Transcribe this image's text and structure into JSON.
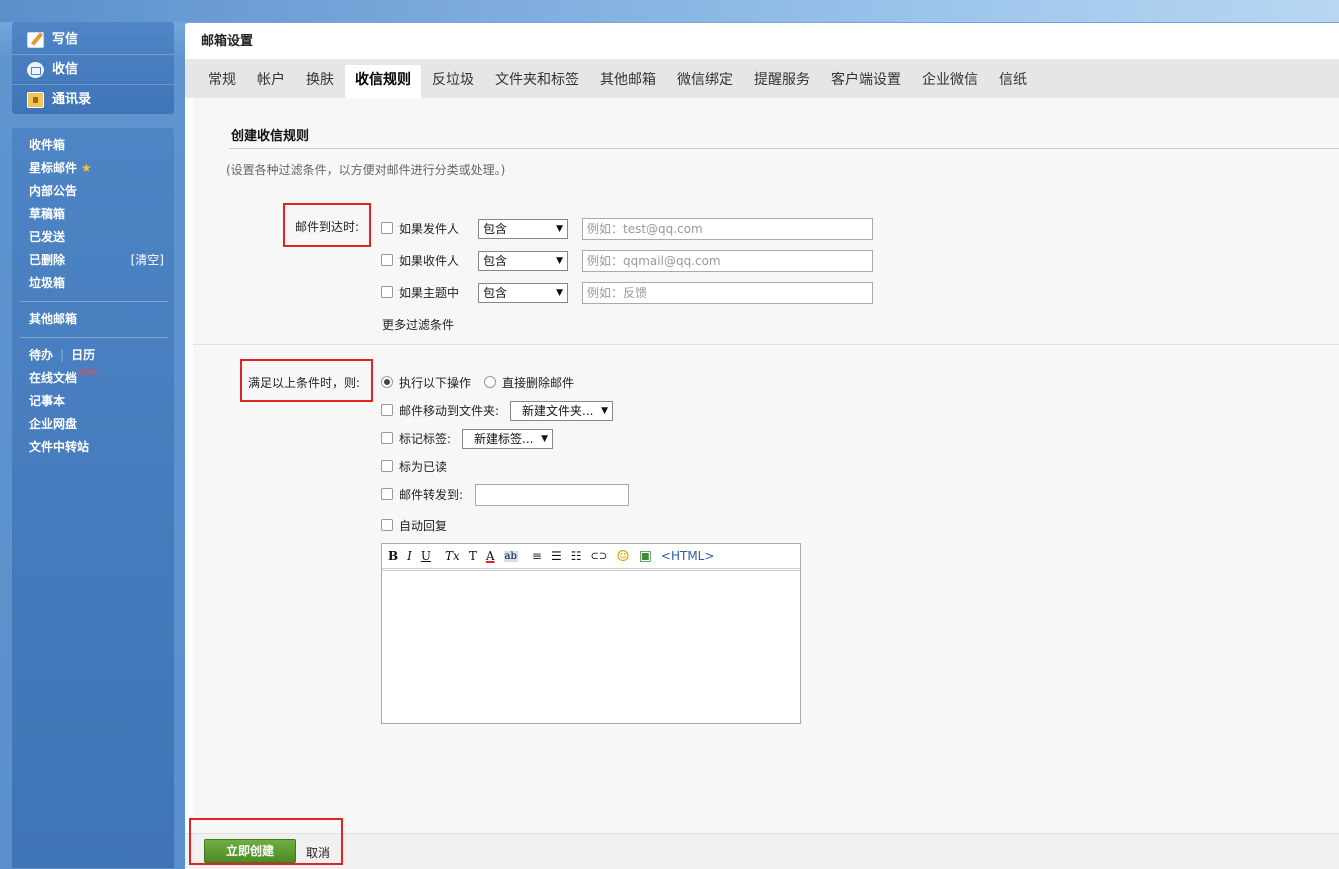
{
  "sidebar": {
    "primary": [
      {
        "label": "写信",
        "icon": "pen-icon"
      },
      {
        "label": "收信",
        "icon": "inbox-icon"
      },
      {
        "label": "通讯录",
        "icon": "contacts-icon"
      }
    ],
    "folders": [
      "收件箱",
      "星标邮件",
      "内部公告",
      "草稿箱",
      "已发送",
      "已删除",
      "垃圾箱"
    ],
    "star": "★",
    "clear": "[清空]",
    "other_mailbox": "其他邮箱",
    "todo": "待办",
    "divider": "|",
    "calendar": "日历",
    "docs": "在线文档",
    "new_badge": "NEW",
    "notebook": "记事本",
    "netdisk": "企业网盘",
    "transfer": "文件中转站"
  },
  "main": {
    "title": "邮箱设置",
    "tabs": [
      "常规",
      "帐户",
      "换肤",
      "收信规则",
      "反垃圾",
      "文件夹和标签",
      "其他邮箱",
      "微信绑定",
      "提醒服务",
      "客户端设置",
      "企业微信",
      "信纸"
    ],
    "active_tab": "收信规则"
  },
  "form": {
    "heading": "创建收信规则",
    "description": "(设置各种过滤条件，以方便对邮件进行分类或处理。)",
    "arrival_label": "邮件到达时:",
    "conditions": [
      {
        "label": "如果发件人",
        "operator": "包含",
        "placeholder": "例如：test@qq.com"
      },
      {
        "label": "如果收件人",
        "operator": "包含",
        "placeholder": "例如：qqmail@qq.com"
      },
      {
        "label": "如果主题中",
        "operator": "包含",
        "placeholder": "例如：反馈"
      }
    ],
    "more_filters": "更多过滤条件",
    "satisfied_label": "满足以上条件时，则:",
    "radio_execute": "执行以下操作",
    "radio_delete": "直接删除邮件",
    "move_label": "邮件移动到文件夹:",
    "move_select": "新建文件夹...",
    "tag_label": "标记标签:",
    "tag_select": "新建标签...",
    "mark_read": "标为已读",
    "forward_label": "邮件转发到:",
    "auto_reply": "自动回复",
    "editor_tools": [
      "B",
      "I",
      "U",
      "Tx",
      "T",
      "A",
      "ab",
      "≡",
      "☰",
      "☷",
      "⊂⊃",
      "☺",
      "▣",
      "<HTML>"
    ]
  },
  "footer": {
    "create": "立即创建",
    "cancel": "取消"
  },
  "colors": {
    "accent": "#4d8a26",
    "highlight": "#e02424",
    "sidebar": "#3f74b6"
  }
}
